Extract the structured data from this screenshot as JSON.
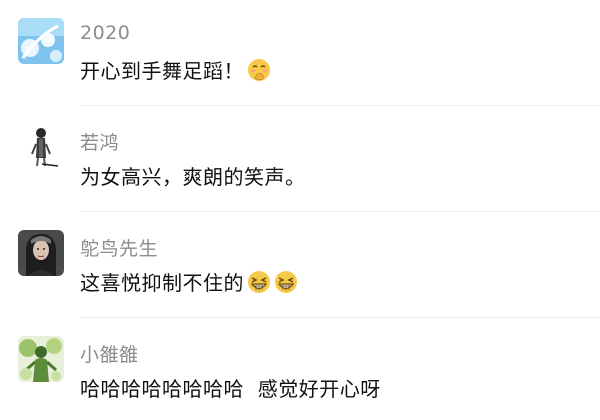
{
  "comments": [
    {
      "username": "2020",
      "text": "开心到手舞足蹈！",
      "avatar_icon": "sky-blue-avatar",
      "emojis": [
        "hand-over-mouth-emoji"
      ]
    },
    {
      "username": "若鸿",
      "text": "为女高兴，爽朗的笑声。",
      "avatar_icon": "ink-figure-avatar",
      "emojis": []
    },
    {
      "username": "鸵鸟先生",
      "text": "这喜悦抑制不住的",
      "avatar_icon": "long-hair-portrait-avatar",
      "emojis": [
        "grinning-squint-emoji",
        "grinning-squint-emoji"
      ]
    },
    {
      "username": "小雒雒",
      "text": "哈哈哈哈哈哈哈哈  感觉好开心呀",
      "avatar_icon": "green-figure-avatar",
      "emojis": []
    }
  ],
  "colors": {
    "username": "#8c8c8c",
    "text": "#111111",
    "divider": "#ececec",
    "emoji_face": "#f7c948"
  }
}
